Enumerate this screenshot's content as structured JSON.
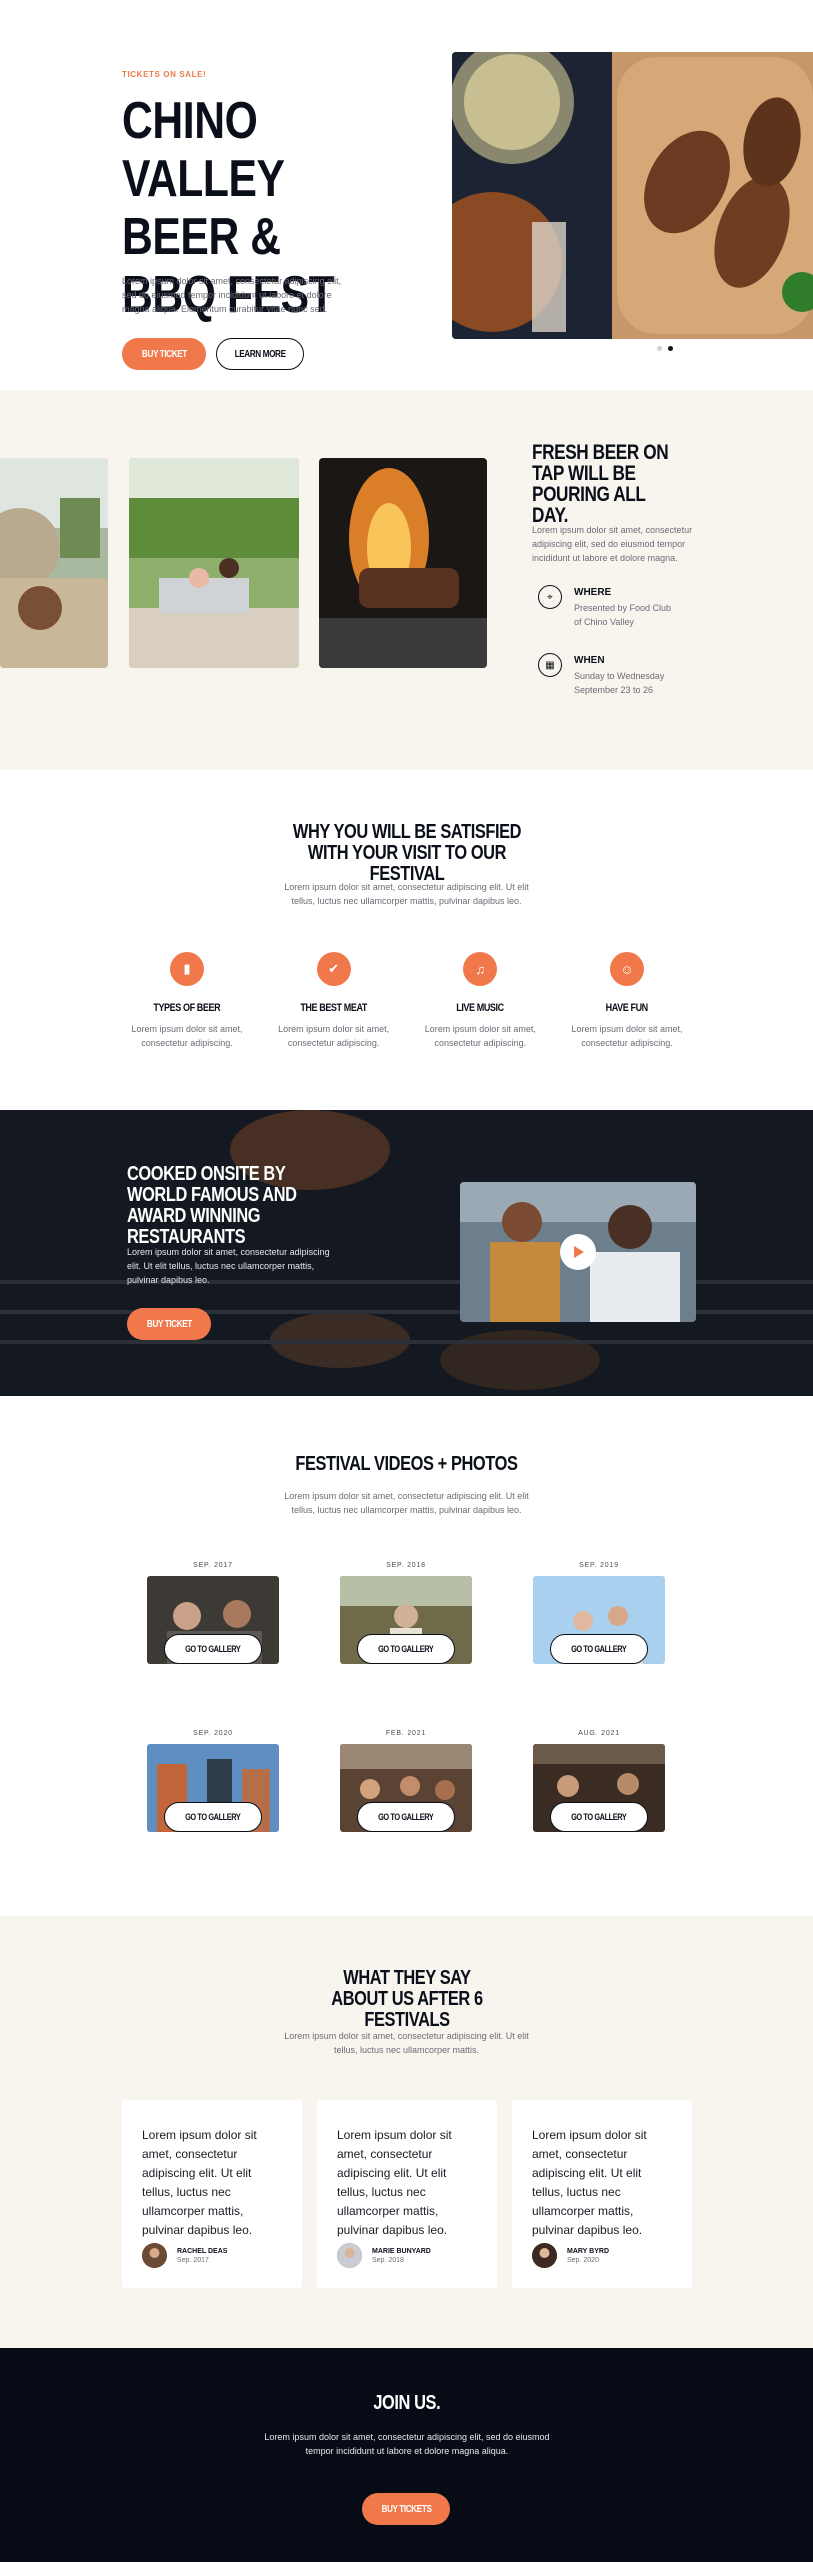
{
  "hero": {
    "kicker": "TICKETS ON SALE!",
    "title": "CHINO VALLEY BEER & BBQ FEST",
    "text": "Lorem ipsum dolor sit amet, consectetur adipiscing elit, sed do eiusmod tempor incididunt ut labore et dolore magna aliqua. Elementum curabitur vitae nunc sed.",
    "buy_label": "BUY TICKET",
    "learn_label": "LEARN MORE"
  },
  "event": {
    "title": "FRESH BEER ON TAP WILL BE POURING ALL DAY.",
    "text": "Lorem ipsum dolor sit amet, consectetur adipiscing elit, sed do eiusmod tempor incididunt ut labore et dolore magna.",
    "where_label": "WHERE",
    "where_value": "Presented by Food Club of Chino Valley",
    "when_label": "WHEN",
    "when_value": "Sunday to Wednesday September 23 to 26"
  },
  "features": {
    "title": "WHY YOU WILL BE SATISFIED WITH YOUR VISIT TO OUR FESTIVAL",
    "text": "Lorem ipsum dolor sit amet, consectetur adipiscing elit. Ut elit tellus, luctus nec ullamcorper mattis, pulvinar dapibus leo.",
    "items": [
      {
        "title": "TYPES OF BEER",
        "text": "Lorem ipsum dolor sit amet, consectetur adipiscing.",
        "icon": "beer-icon"
      },
      {
        "title": "THE BEST MEAT",
        "text": "Lorem ipsum dolor sit amet, consectetur adipiscing.",
        "icon": "check-icon"
      },
      {
        "title": "LIVE MUSIC",
        "text": "Lorem ipsum dolor sit amet, consectetur adipiscing.",
        "icon": "music-icon"
      },
      {
        "title": "HAVE FUN",
        "text": "Lorem ipsum dolor sit amet, consectetur adipiscing.",
        "icon": "smile-icon"
      }
    ]
  },
  "cooked": {
    "title": "COOKED ONSITE BY WORLD FAMOUS AND AWARD WINNING RESTAURANTS",
    "text": "Lorem ipsum dolor sit amet, consectetur adipiscing elit. Ut elit tellus, luctus nec ullamcorper mattis, pulvinar dapibus leo.",
    "buy_label": "BUY TICKET"
  },
  "gallery": {
    "title": "FESTIVAL VIDEOS + PHOTOS",
    "text": "Lorem ipsum dolor sit amet, consectetur adipiscing elit. Ut elit tellus, luctus nec ullamcorper mattis, pulvinar dapibus leo.",
    "button_label": "GO TO GALLERY",
    "items": [
      {
        "date": "SEP. 2017"
      },
      {
        "date": "SEP. 2018"
      },
      {
        "date": "SEP. 2019"
      },
      {
        "date": "SEP. 2020"
      },
      {
        "date": "FEB. 2021"
      },
      {
        "date": "AUG. 2021"
      }
    ]
  },
  "testimonials": {
    "title": "WHAT THEY SAY ABOUT US AFTER 6 FESTIVALS",
    "text": "Lorem ipsum dolor sit amet, consectetur adipiscing elit. Ut elit tellus, luctus nec ullamcorper mattis.",
    "items": [
      {
        "quote": "Lorem ipsum dolor sit amet, consectetur adipiscing elit. Ut elit tellus, luctus nec ullamcorper mattis, pulvinar dapibus leo.",
        "name": "RACHEL DEAS",
        "date": "Sep. 2017"
      },
      {
        "quote": "Lorem ipsum dolor sit amet, consectetur adipiscing elit. Ut elit tellus, luctus nec ullamcorper mattis, pulvinar dapibus leo.",
        "name": "MARIE BUNYARD",
        "date": "Sep. 2018"
      },
      {
        "quote": "Lorem ipsum dolor sit amet, consectetur adipiscing elit. Ut elit tellus, luctus nec ullamcorper mattis, pulvinar dapibus leo.",
        "name": "MARY BYRD",
        "date": "Sep. 2020"
      }
    ]
  },
  "join": {
    "title": "JOIN US.",
    "text": "Lorem ipsum dolor sit amet, consectetur adipiscing elit, sed do eiusmod tempor incididunt ut labore et dolore magna aliqua.",
    "button_label": "BUY TICKETS"
  },
  "colors": {
    "accent": "#f0784a",
    "dark": "#0b0f19",
    "cream": "#f8f5ef",
    "footer": "#070b16"
  }
}
